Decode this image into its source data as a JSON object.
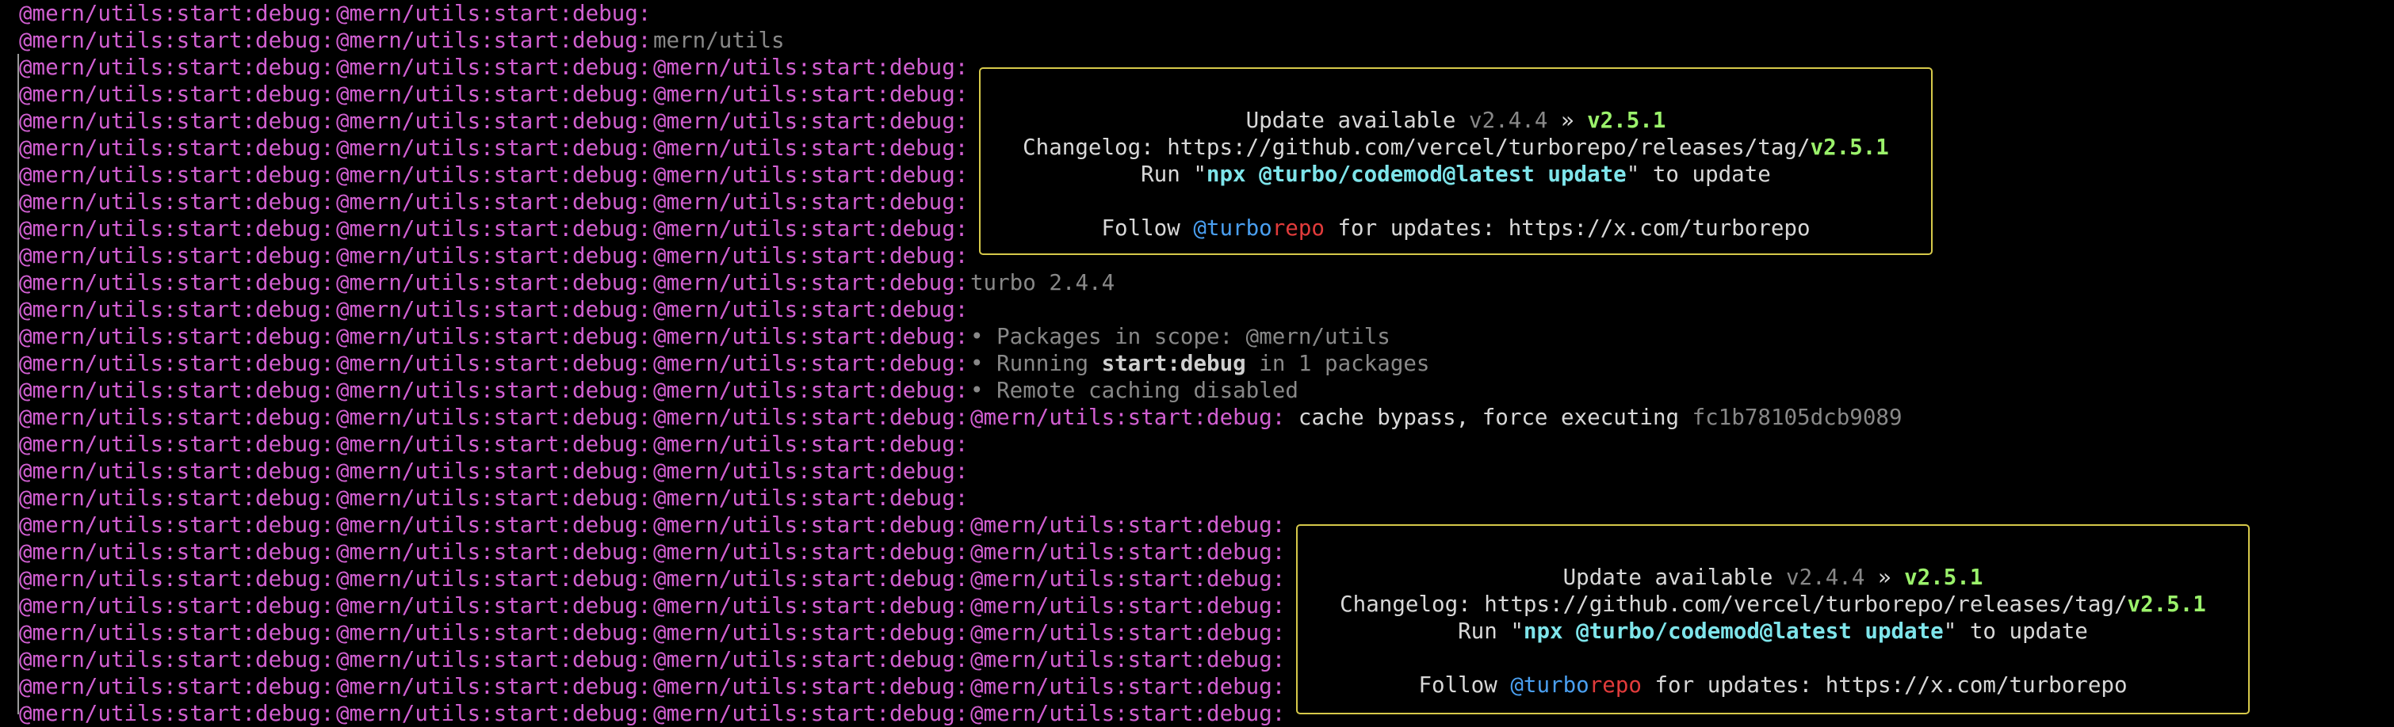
{
  "prefix": "@mern/utils:start:debug:",
  "top_line_2_text": "mern/utils",
  "turbo_version_text": "turbo 2.4.4",
  "scope_text": "• Packages in scope: @mern/utils",
  "running_before": "• Running ",
  "running_task": "start:debug",
  "running_after": " in 1 packages",
  "remote_caching_text": "• Remote caching disabled",
  "cache_prefix": "@mern/utils:start:debug:",
  "cache_text": " cache bypass, force executing ",
  "cache_hash": "fc1b78105dcb9089",
  "update_box": {
    "update_available": "Update available ",
    "current_version": "v2.4.4",
    "arrow": " » ",
    "new_version": "v2.5.1",
    "changelog_label": "Changelog: https://github.com/vercel/turborepo/releases/tag/",
    "run_before": "Run \"",
    "run_command": "npx @turbo/codemod@latest update",
    "run_after": "\" to update",
    "follow_before": "Follow ",
    "handle_turbo": "@turbo",
    "handle_repo": "repo",
    "follow_after": " for updates: https://x.com/turborepo"
  },
  "colors": {
    "background": "#000000",
    "prefix_purple": "#d15fd1",
    "box_border": "#d6c94a",
    "green": "#9bf26b",
    "cyan": "#7ee4ea",
    "blue": "#4a9ff0",
    "red": "#e23b3b"
  }
}
